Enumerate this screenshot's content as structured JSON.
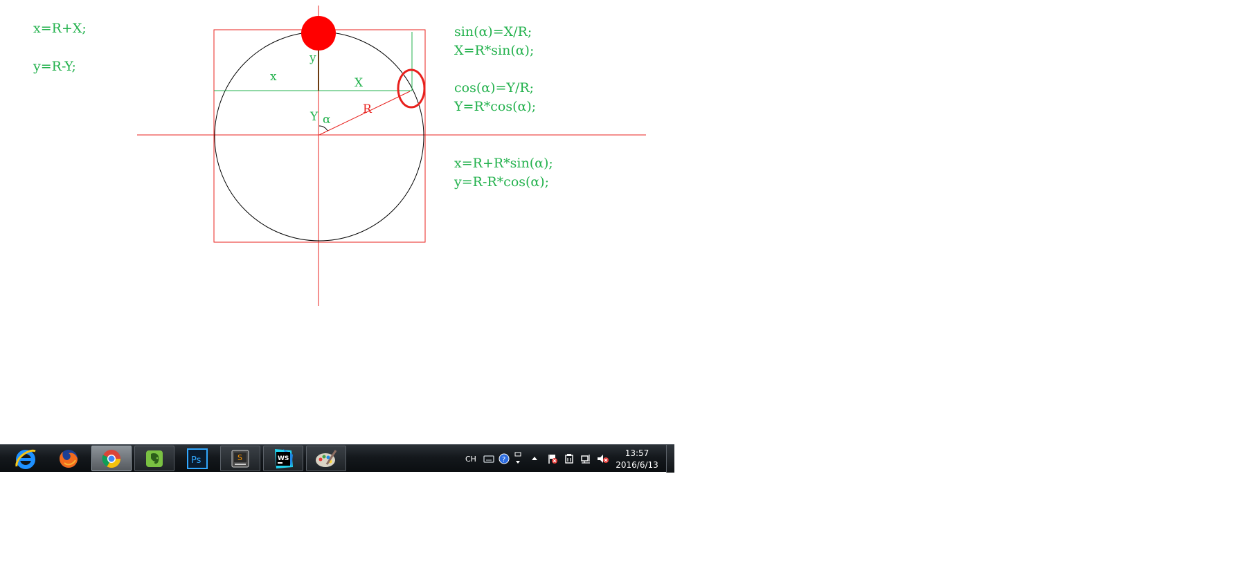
{
  "left_notes": {
    "line1": "x=R+X;",
    "line2": "y=R-Y;"
  },
  "right_notes": {
    "sin_def": "sin(α)=X/R;",
    "x_solve": "X=R*sin(α);",
    "cos_def": "cos(α)=Y/R;",
    "y_solve": "Y=R*cos(α);",
    "x_final": "x=R+R*sin(α);",
    "y_final": "y=R-R*cos(α);"
  },
  "diagram_labels": {
    "small_x": "x",
    "small_y": "y",
    "big_x": "X",
    "big_y": "Y",
    "alpha": "α",
    "radius": "R"
  },
  "colors": {
    "green": "#22b14c",
    "red": "#e8201c",
    "circle": "#000000"
  },
  "taskbar": {
    "apps": [
      {
        "name": "internet-explorer-icon",
        "label": "Internet Explorer"
      },
      {
        "name": "firefox-icon",
        "label": "Firefox"
      },
      {
        "name": "chrome-icon",
        "label": "Chrome"
      },
      {
        "name": "evernote-icon",
        "label": "Evernote"
      },
      {
        "name": "photoshop-icon",
        "label": "Ps"
      },
      {
        "name": "sublime-text-icon",
        "label": "S"
      },
      {
        "name": "webstorm-icon",
        "label": "WS"
      },
      {
        "name": "paint-icon",
        "label": "Paint"
      }
    ],
    "language": "CH",
    "time": "13:57",
    "date": "2016/6/13"
  }
}
